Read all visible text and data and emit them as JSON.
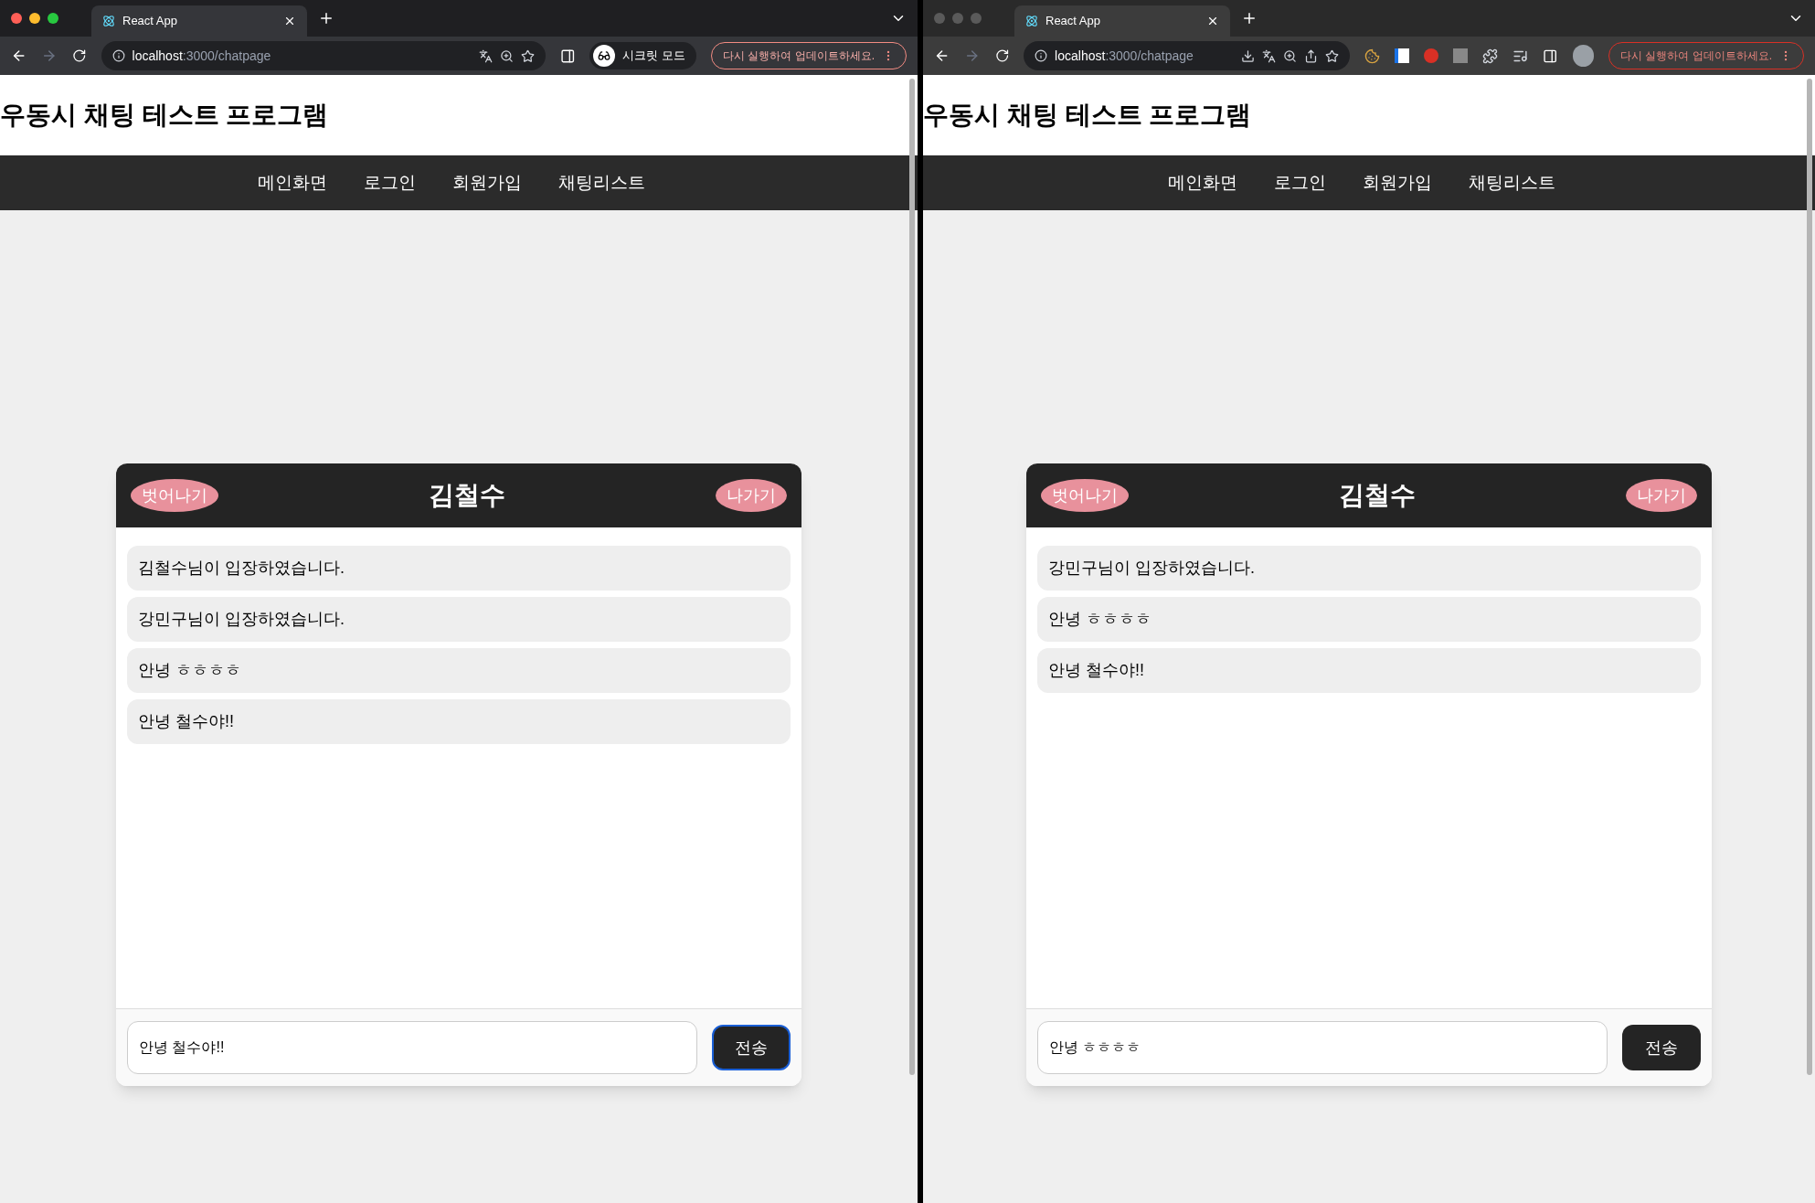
{
  "windows": [
    {
      "active": true,
      "tab_title": "React App",
      "url_host": "localhost",
      "url_path": ":3000/chatpage",
      "incognito_badge": {
        "label": "시크릿 모드"
      },
      "extensions_pinned": false,
      "update_button": {
        "label": "다시 실행하여 업데이트하세요."
      },
      "page": {
        "title": "우동시 채팅 테스트 프로그램",
        "nav": [
          {
            "label": "메인화면"
          },
          {
            "label": "로그인"
          },
          {
            "label": "회원가입"
          },
          {
            "label": "채팅리스트"
          }
        ],
        "chat": {
          "name": "김철수",
          "left_button": "벗어나기",
          "right_button": "나가기",
          "messages": [
            "김철수님이 입장하였습니다.",
            "강민구님이 입장하였습니다.",
            "안녕 ㅎㅎㅎㅎ",
            "안녕 철수야!!"
          ],
          "input_value": "안녕 철수야!!",
          "send_label": "전송",
          "send_focused": true
        }
      }
    },
    {
      "active": false,
      "tab_title": "React App",
      "url_host": "localhost",
      "url_path": ":3000/chatpage",
      "extensions_pinned": true,
      "update_button": {
        "label": "다시 실행하여 업데이트하세요."
      },
      "page": {
        "title": "우동시 채팅 테스트 프로그램",
        "nav": [
          {
            "label": "메인화면"
          },
          {
            "label": "로그인"
          },
          {
            "label": "회원가입"
          },
          {
            "label": "채팅리스트"
          }
        ],
        "chat": {
          "name": "김철수",
          "left_button": "벗어나기",
          "right_button": "나가기",
          "messages": [
            "강민구님이 입장하였습니다.",
            "안녕 ㅎㅎㅎㅎ",
            "안녕 철수야!!"
          ],
          "input_value": "안녕 ㅎㅎㅎㅎ",
          "send_label": "전송",
          "send_focused": false
        }
      }
    }
  ]
}
